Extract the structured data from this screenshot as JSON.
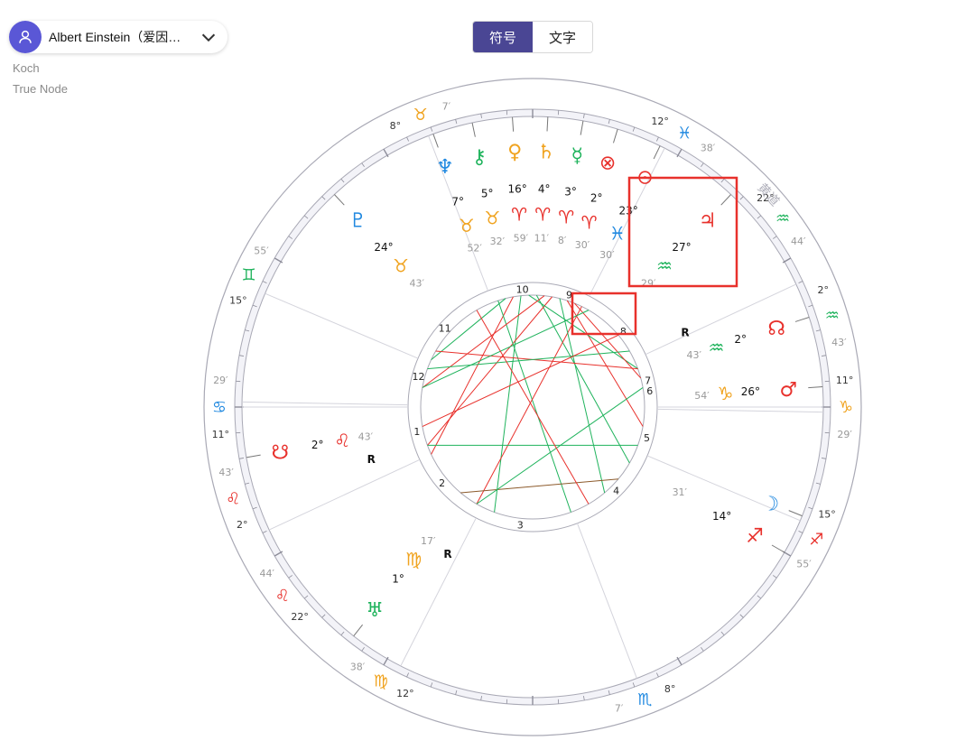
{
  "header": {
    "person_name": "Albert Einstein（爱因…",
    "house_system": "Koch",
    "node_type": "True Node",
    "icons": {
      "avatar": "user-icon",
      "dropdown": "chevron-down-icon"
    }
  },
  "tabs": [
    {
      "label": "符号",
      "active": true
    },
    {
      "label": "文字",
      "active": false
    }
  ],
  "colors": {
    "fire": "#e8312c",
    "earth": "#f0a31f",
    "air": "#1fb35c",
    "water": "#2189e0",
    "tab_active": "#4a4694",
    "highlight": "#e8312c"
  },
  "chart": {
    "outer_ring": [
      {
        "sign": "♉",
        "deg": "8°",
        "min": "7′",
        "color": "#f0a31f",
        "angle": 111
      },
      {
        "sign": "♓",
        "deg": "12°",
        "min": "38′",
        "color": "#2189e0",
        "angle": 61
      },
      {
        "sign": "♒",
        "deg": "22°",
        "min": "44′",
        "color": "#1fb35c",
        "angle": 37
      },
      {
        "sign": "♒",
        "deg": "2°",
        "min": "43′",
        "color": "#1fb35c",
        "angle": 17
      },
      {
        "sign": "♑",
        "deg": "11°",
        "min": "29′",
        "color": "#f0a31f",
        "angle": 0
      },
      {
        "sign": "♐",
        "deg": "15°",
        "min": "55′",
        "color": "#e8312c",
        "angle": -25
      },
      {
        "sign": "♏",
        "deg": "8°",
        "min": "7′",
        "color": "#2189e0",
        "angle": -69
      },
      {
        "sign": "♍",
        "deg": "12°",
        "min": "38′",
        "color": "#f0a31f",
        "angle": -119
      },
      {
        "sign": "♌",
        "deg": "22°",
        "min": "44′",
        "color": "#e8312c",
        "angle": -143
      },
      {
        "sign": "♌",
        "deg": "2°",
        "min": "43′",
        "color": "#e8312c",
        "angle": -163
      },
      {
        "sign": "♋",
        "deg": "11°",
        "min": "29′",
        "color": "#2189e0",
        "angle": 180
      },
      {
        "sign": "♊",
        "deg": "15°",
        "min": "55′",
        "color": "#1fb35c",
        "angle": 155
      }
    ],
    "ecliptic_label": "黄道",
    "houses": [
      "1",
      "2",
      "3",
      "4",
      "5",
      "6",
      "7",
      "8",
      "9",
      "10",
      "11",
      "12"
    ],
    "planets": [
      {
        "glyph": "♆",
        "deg": "7°",
        "sign": "♉",
        "min": "52′",
        "color": "#2189e0",
        "sign_color": "#f0a31f",
        "angle": 110
      },
      {
        "glyph": "⚷",
        "deg": "5°",
        "sign": "♉",
        "min": "32′",
        "color": "#1fb35c",
        "sign_color": "#f0a31f",
        "angle": 102
      },
      {
        "glyph": "♀",
        "deg": "16°",
        "sign": "♈",
        "min": "59′",
        "color": "#f0a31f",
        "sign_color": "#e8312c",
        "angle": 94
      },
      {
        "glyph": "♄",
        "deg": "4°",
        "sign": "♈",
        "min": "11′",
        "color": "#f0a31f",
        "sign_color": "#e8312c",
        "angle": 87
      },
      {
        "glyph": "☿",
        "deg": "3°",
        "sign": "♈",
        "min": "8′",
        "color": "#1fb35c",
        "sign_color": "#e8312c",
        "angle": 80
      },
      {
        "glyph": "⊗",
        "deg": "2°",
        "sign": "♈",
        "min": "30′",
        "color": "#e8312c",
        "sign_color": "#e8312c",
        "angle": 73
      },
      {
        "glyph": "⊙",
        "deg": "23°",
        "sign": "♓",
        "min": "30′",
        "color": "#e8312c",
        "sign_color": "#2189e0",
        "angle": 64
      },
      {
        "glyph": "♃",
        "deg": "27°",
        "sign": "♒",
        "min": "29′",
        "color": "#e8312c",
        "sign_color": "#1fb35c",
        "angle": 47
      },
      {
        "glyph": "♇",
        "deg": "24°",
        "sign": "♉",
        "min": "43′",
        "color": "#2189e0",
        "sign_color": "#f0a31f",
        "angle": 133
      },
      {
        "glyph": "☊",
        "deg": "2°",
        "sign": "♒",
        "min": "43′",
        "retro": "R",
        "color": "#e8312c",
        "sign_color": "#1fb35c",
        "angle": 18
      },
      {
        "glyph": "♂",
        "deg": "26°",
        "sign": "♑",
        "min": "54′",
        "color": "#e8312c",
        "sign_color": "#f0a31f",
        "angle": 4
      },
      {
        "glyph": "♐",
        "deg": "14°",
        "sign": "",
        "min": "31′",
        "color": "#e8312c",
        "sign_color": "#e8312c",
        "angle": -30
      },
      {
        "glyph": "☽",
        "deg": "",
        "sign": "",
        "min": "",
        "color": "#2189e0",
        "sign_color": "#2189e0",
        "angle": -22
      },
      {
        "glyph": "☋",
        "deg": "2°",
        "sign": "♌",
        "min": "43′",
        "retro": "R",
        "color": "#e8312c",
        "sign_color": "#e8312c",
        "angle": -170
      },
      {
        "glyph": "♅",
        "deg": "1°",
        "sign": "♍",
        "min": "17′",
        "retro": "R",
        "color": "#1fb35c",
        "sign_color": "#f0a31f",
        "angle": -128
      }
    ]
  }
}
